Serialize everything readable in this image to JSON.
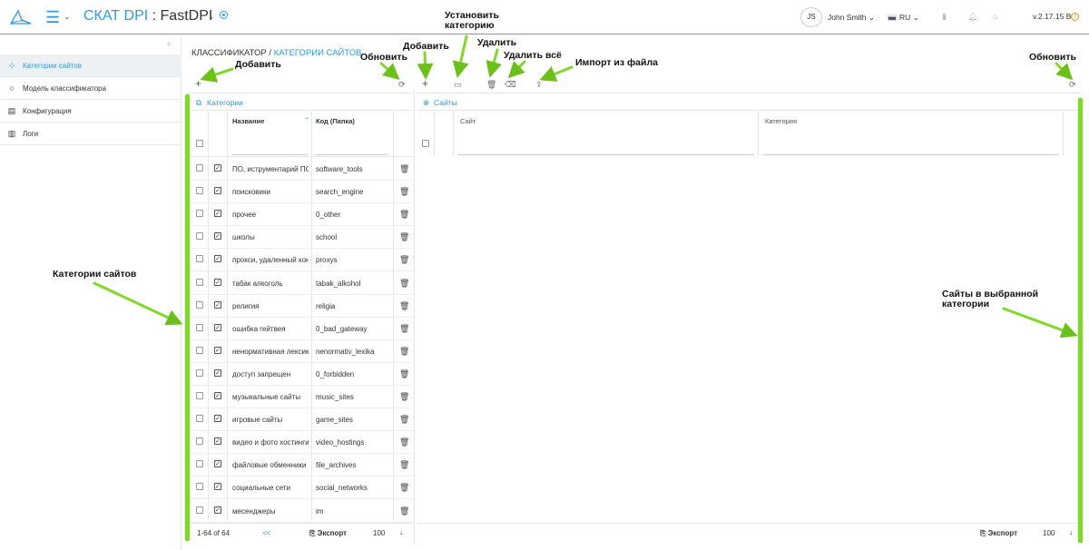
{
  "header": {
    "app_name": "СКАТ DPI",
    "separator": " : ",
    "product": "FastDPI",
    "user_initials": "JS",
    "user_name": "John Smith",
    "language": "RU",
    "version": "v.2.17.15 B",
    "version_warn": "!"
  },
  "sidebar": {
    "collapse_icon": "«",
    "items": [
      {
        "label": "Категории сайтов",
        "icon": "sitemap-icon",
        "active": true
      },
      {
        "label": "Модель классификатора",
        "icon": "circle-icon",
        "active": false
      },
      {
        "label": "Конфигурация",
        "icon": "list-icon",
        "active": false
      },
      {
        "label": "Логи",
        "icon": "bar-chart-icon",
        "active": false
      }
    ]
  },
  "breadcrumb": {
    "root": "КЛАССИФИКАТОР",
    "sep": " / ",
    "current": "КАТЕГОРИИ САЙТОВ"
  },
  "categories_panel": {
    "title": "Категории",
    "col_name": "Название",
    "col_code": "Код (Папка)",
    "rows": [
      {
        "name": "ПО, иструментарий ПО",
        "code": "software_tools"
      },
      {
        "name": "поисковики",
        "code": "search_engine"
      },
      {
        "name": "прочее",
        "code": "0_other"
      },
      {
        "name": "школы",
        "code": "school"
      },
      {
        "name": "прокси, удаленный конт",
        "code": "proxys"
      },
      {
        "name": "табак алкоголь",
        "code": "tabak_alkohol"
      },
      {
        "name": "религия",
        "code": "religia"
      },
      {
        "name": "ошибка гейтвея",
        "code": "0_bad_gateway"
      },
      {
        "name": "ненормативная лексика",
        "code": "nenormativ_lexika"
      },
      {
        "name": "доступ запрещен",
        "code": "0_forbidden"
      },
      {
        "name": "музыкальные сайты",
        "code": "music_sites"
      },
      {
        "name": "игровые сайты",
        "code": "game_sites"
      },
      {
        "name": "видео и фото хостинги",
        "code": "video_hostings"
      },
      {
        "name": "файловые обменники",
        "code": "file_archives"
      },
      {
        "name": "социальные сети",
        "code": "social_networks"
      },
      {
        "name": "месенджеры",
        "code": "im"
      }
    ],
    "footer": {
      "range": "1-64 of 64",
      "first": "<<",
      "export": "Экспорт",
      "page_size": "100"
    }
  },
  "sites_panel": {
    "title": "Сайты",
    "col_site": "Сайт",
    "col_category": "Категория",
    "footer": {
      "export": "Экспорт",
      "page_size": "100"
    }
  },
  "annotations": {
    "add_left": "Добавить",
    "refresh_left": "Обновить",
    "add_right": "Добавить",
    "set_category": "Установить\nкатегорию",
    "delete": "Удалить",
    "delete_all": "Удалить всё",
    "import": "Импорт из файла",
    "refresh_right": "Обновить",
    "categories": "Категории сайтов",
    "sites": "Сайты в выбранной\nкатегории"
  },
  "colors": {
    "accent": "#2b9be0",
    "highlight": "#7fd82a",
    "warn": "#f08a00"
  }
}
